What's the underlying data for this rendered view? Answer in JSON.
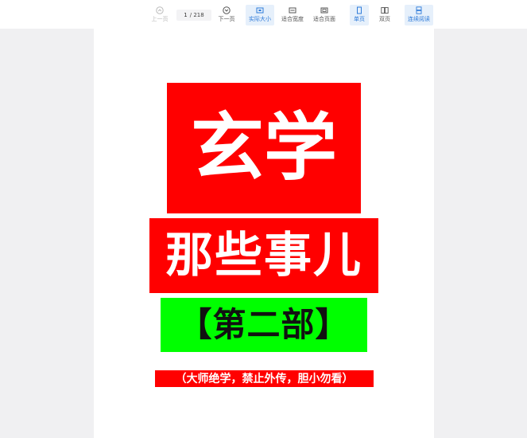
{
  "toolbar": {
    "prev_label": "上一页",
    "page_current": "1",
    "page_total": "/ 218",
    "next_label": "下一页",
    "actual_size_label": "实际大小",
    "fit_width_label": "适合宽度",
    "fit_page_label": "适合页面",
    "single_page_label": "单页",
    "double_page_label": "双页",
    "continuous_label": "连续阅读",
    "accent_color": "#2f7bd9",
    "icons": [
      "chevron-up-icon",
      "chevron-down-icon",
      "actual-size-icon",
      "fit-width-icon",
      "fit-page-icon",
      "single-page-icon",
      "double-page-icon",
      "continuous-icon"
    ]
  },
  "document": {
    "title": "玄学",
    "subtitle": "那些事儿",
    "part": "【第二部】",
    "note": "（大师绝学，禁止外传，胆小勿看）",
    "colors": {
      "title_bg": "#ff0000",
      "part_bg": "#00ff00",
      "text_white": "#ffffff",
      "text_dark": "#111111"
    }
  }
}
